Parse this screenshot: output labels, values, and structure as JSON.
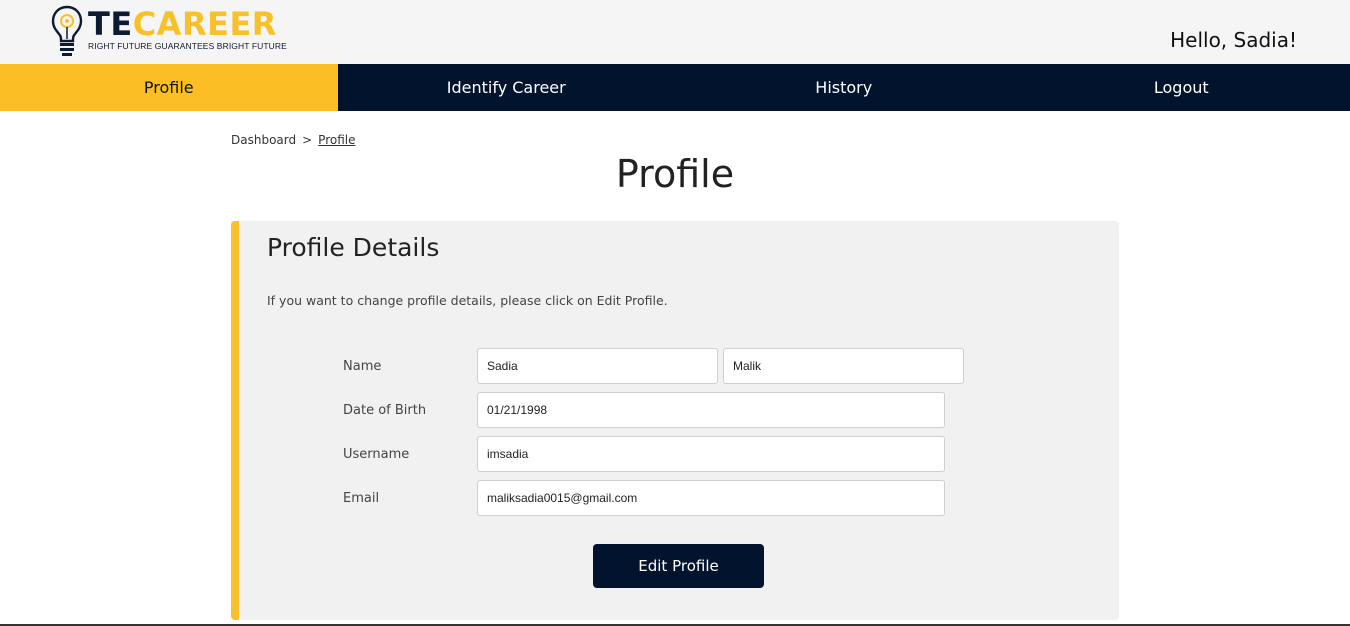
{
  "header": {
    "logo_te": "TE",
    "logo_career": "CAREER",
    "logo_tagline": "RIGHT FUTURE GUARANTEES BRIGHT FUTURE",
    "greeting": "Hello, Sadia!"
  },
  "nav": {
    "items": [
      {
        "label": "Profile",
        "active": true
      },
      {
        "label": "Identify Career",
        "active": false
      },
      {
        "label": "History",
        "active": false
      },
      {
        "label": "Logout",
        "active": false
      }
    ]
  },
  "breadcrumb": {
    "root": "Dashboard",
    "separator": ">",
    "current": "Profile"
  },
  "page": {
    "title": "Profile"
  },
  "profile_card": {
    "title": "Profile Details",
    "note": "If you want to change profile details, please click on Edit Profile.",
    "fields": {
      "name_label": "Name",
      "first_name": "Sadia",
      "last_name": "Malik",
      "dob_label": "Date of Birth",
      "dob": "01/21/1998",
      "username_label": "Username",
      "username": "imsadia",
      "email_label": "Email",
      "email": "maliksadia0015@gmail.com"
    },
    "edit_button": "Edit Profile"
  },
  "colors": {
    "accent": "#f8c02a",
    "nav_bg": "#02142d",
    "card_bg": "#f1f1f1"
  }
}
